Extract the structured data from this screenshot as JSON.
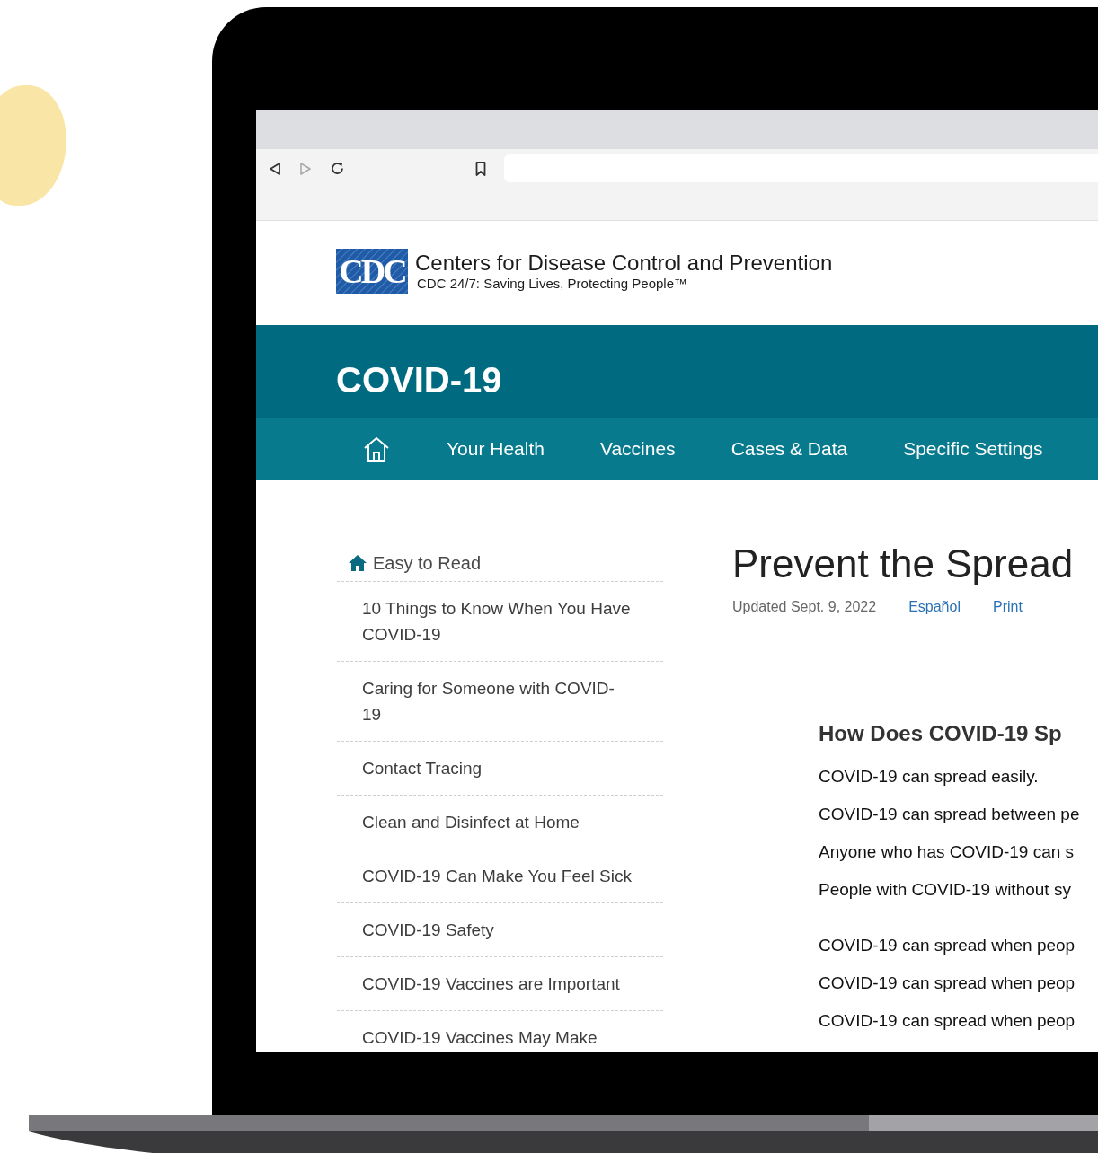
{
  "site_header": {
    "logo_text": "CDC",
    "org_name": "Centers for Disease Control and Prevention",
    "tagline": "CDC 24/7: Saving Lives, Protecting People™"
  },
  "banner": {
    "title": "COVID-19"
  },
  "nav": {
    "items": [
      {
        "kind": "home"
      },
      {
        "kind": "link",
        "label": "Your Health"
      },
      {
        "kind": "link",
        "label": "Vaccines"
      },
      {
        "kind": "link",
        "label": "Cases & Data"
      },
      {
        "kind": "link",
        "label": "Specific Settings"
      }
    ]
  },
  "sidebar": {
    "heading": "Easy to Read",
    "items": [
      "10 Things to Know When You Have COVID-19",
      "Caring for Someone with COVID-19",
      "Contact Tracing",
      "Clean and Disinfect at Home",
      "COVID-19 Can Make You Feel Sick",
      "COVID-19 Safety",
      "COVID-19 Vaccines are Important",
      "COVID-19 Vaccines May Make"
    ]
  },
  "article": {
    "title": "Prevent the Spread",
    "updated": "Updated Sept. 9, 2022",
    "links": [
      "Español",
      "Print"
    ],
    "section_heading": "How Does COVID-19 Sp",
    "paragraph_groups": [
      [
        "COVID-19 can spread easily.",
        "COVID-19 can spread between pe",
        "Anyone who has COVID-19 can s",
        "People with COVID-19 without sy"
      ],
      [
        "COVID-19 can spread when peop",
        "COVID-19 can spread when peop",
        "COVID-19 can spread when peop"
      ]
    ]
  }
}
